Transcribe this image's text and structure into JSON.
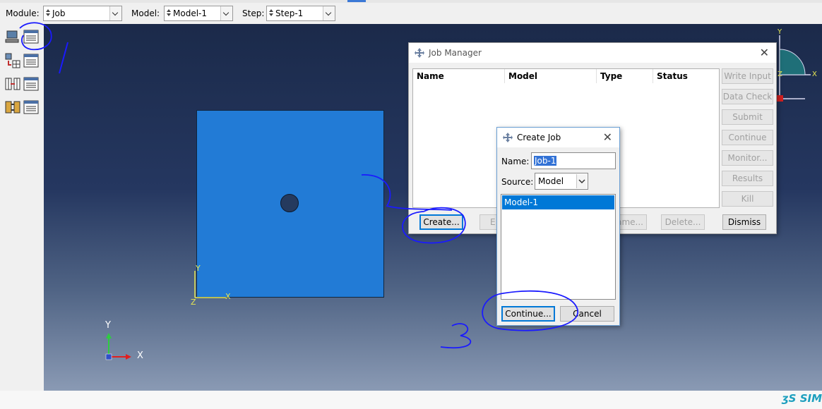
{
  "toolbar": {
    "module_label": "Module:",
    "module_value": "Job",
    "model_label": "Model:",
    "model_value": "Model-1",
    "step_label": "Step:",
    "step_value": "Step-1"
  },
  "left_toolbox": {
    "tools": [
      "job-computer-icon",
      "job-manager-icon",
      "adaptivity-icon",
      "adaptivity-manager-icon",
      "coexecution-icon",
      "coexecution-manager-icon",
      "optimization-icon",
      "optimization-manager-icon"
    ]
  },
  "viewport": {
    "local_axes": {
      "x": "X",
      "y": "Y",
      "z": "Z"
    },
    "global_triad": {
      "x": "X",
      "y": "Y",
      "z": "Z"
    },
    "part_color": "#227bd6",
    "background_top": "#1b2a4a",
    "background_bottom": "#8a9ab4"
  },
  "job_manager": {
    "title": "Job Manager",
    "columns": [
      "Name",
      "Model",
      "Type",
      "Status"
    ],
    "side_buttons": [
      "Write Input",
      "Data Check",
      "Submit",
      "Continue",
      "Monitor...",
      "Results",
      "Kill"
    ],
    "create_label": "Create...",
    "edit_label": "E",
    "rename_label": "ame...",
    "delete_label": "Delete...",
    "dismiss_label": "Dismiss"
  },
  "create_job": {
    "title": "Create Job",
    "name_label": "Name:",
    "name_value": "Job-1",
    "source_label": "Source:",
    "source_value": "Model",
    "models": [
      "Model-1"
    ],
    "selected_model": "Model-1",
    "continue_label": "Continue...",
    "cancel_label": "Cancel"
  },
  "annotations": {
    "step_1": "1",
    "step_2": "2",
    "step_3": "3",
    "ink_color": "#1a1aff"
  },
  "brand": {
    "logo_text": "SIM"
  }
}
